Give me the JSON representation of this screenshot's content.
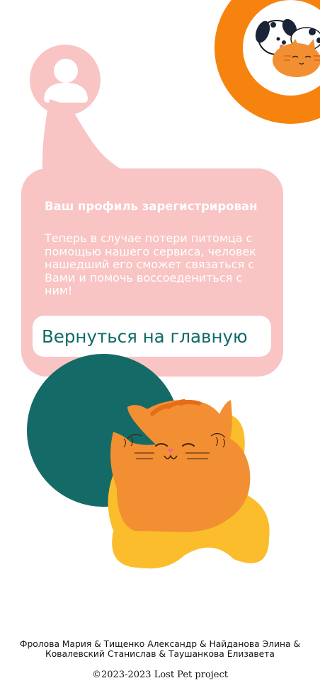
{
  "card": {
    "title": "Ваш профиль зарегистрирован",
    "text": "Теперь в случае потери питомца с помощью нашего сервиса, человек нашедший его сможет связаться с Вами и помочь воссоедениться с ним!",
    "button_label": "Вернуться на главную"
  },
  "footer": {
    "authors_line1": "Фролова Мария & Тищенко Александр & Найданова Элина &",
    "authors_line2": "Ковалевский Станислав & Таушанкова Елизавета",
    "copyright": "©2023-2023 Lost Pet project"
  },
  "icons": {
    "logo": "dog-and-cat-logo",
    "avatar": "user-avatar-icon",
    "mascot": "orange-cat-illustration"
  },
  "colors": {
    "pink": "#f9c4c4",
    "orange": "#f7830f",
    "teal": "#146a66",
    "yellow": "#fbbd2b",
    "cat_orange": "#f28f32"
  }
}
